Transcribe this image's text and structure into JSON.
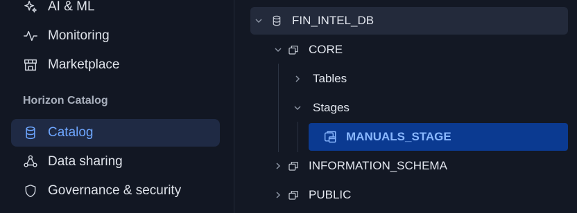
{
  "sidebar": {
    "items": [
      {
        "label": "AI & ML",
        "icon": "sparkle-icon"
      },
      {
        "label": "Monitoring",
        "icon": "activity-icon"
      },
      {
        "label": "Marketplace",
        "icon": "store-icon"
      }
    ],
    "section_label": "Horizon Catalog",
    "catalog_items": [
      {
        "label": "Catalog",
        "icon": "database-icon"
      },
      {
        "label": "Data sharing",
        "icon": "share-icon"
      },
      {
        "label": "Governance & security",
        "icon": "shield-icon"
      }
    ]
  },
  "tree": {
    "database": "FIN_INTEL_DB",
    "schema_core": "CORE",
    "tables": "Tables",
    "stages": "Stages",
    "stage_selected": "MANUALS_STAGE",
    "schema_info": "INFORMATION_SCHEMA",
    "schema_public": "PUBLIC"
  },
  "colors": {
    "accent": "#6ea6ff",
    "selected_bg": "#0b3a91",
    "active_nav_bg": "#1f2a44",
    "background": "#131824"
  }
}
